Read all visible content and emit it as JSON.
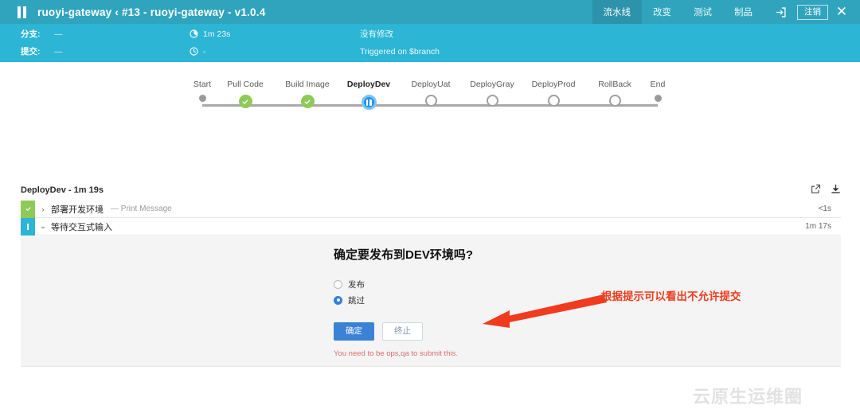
{
  "titlebar": {
    "pause_icon": "pause-icon",
    "title": "ruoyi-gateway ‹ #13 - ruoyi-gateway - v1.0.4",
    "nav": [
      {
        "label": "流水线",
        "active": true
      },
      {
        "label": "改变",
        "active": false
      },
      {
        "label": "测试",
        "active": false
      },
      {
        "label": "制品",
        "active": false
      }
    ],
    "enter_icon": "enter-arrow-icon",
    "logout_label": "注销",
    "close_icon": "close-icon",
    "bg_color": "#31a4bd"
  },
  "infobar": {
    "bg_color": "#2cb5d4",
    "branch_label": "分支:",
    "branch_value": "—",
    "commit_label": "提交:",
    "commit_value": "—",
    "duration_icon": "progress-clock-icon",
    "duration_value": "1m 23s",
    "time_icon": "clock-icon",
    "time_value": "-",
    "changes_text": "没有修改",
    "trigger_text": "Triggered on $branch"
  },
  "stages": [
    {
      "label": "Start",
      "state": "dot"
    },
    {
      "label": "Pull Code",
      "state": "done"
    },
    {
      "label": "Build Image",
      "state": "done"
    },
    {
      "label": "DeployDev",
      "state": "active"
    },
    {
      "label": "DeployUat",
      "state": "todo"
    },
    {
      "label": "DeployGray",
      "state": "todo"
    },
    {
      "label": "DeployProd",
      "state": "todo"
    },
    {
      "label": "RollBack",
      "state": "todo"
    },
    {
      "label": "End",
      "state": "dot"
    }
  ],
  "log": {
    "title": "DeployDev - 1m 19s",
    "open_icon": "external-link-icon",
    "download_icon": "download-icon",
    "steps": [
      {
        "status": "success",
        "caret": "›",
        "name": "部署开发环境",
        "sub": "— Print Message",
        "time": "<1s"
      },
      {
        "status": "paused",
        "caret": "⌄",
        "name": "等待交互式输入",
        "sub": "",
        "time": "1m 17s"
      }
    ]
  },
  "dialog": {
    "question": "确定要发布到DEV环境吗?",
    "options": [
      {
        "label": "发布",
        "checked": false
      },
      {
        "label": "跳过",
        "checked": true
      }
    ],
    "confirm_label": "确定",
    "abort_label": "终止",
    "error_text": "You need to be ops,qa to submit this."
  },
  "annotation": {
    "text": "根据提示可以看出不允许提交",
    "color": "#f03b1e",
    "arrow": "left-pointing-arrow"
  },
  "watermark": {
    "text": "云原生运维圈"
  }
}
